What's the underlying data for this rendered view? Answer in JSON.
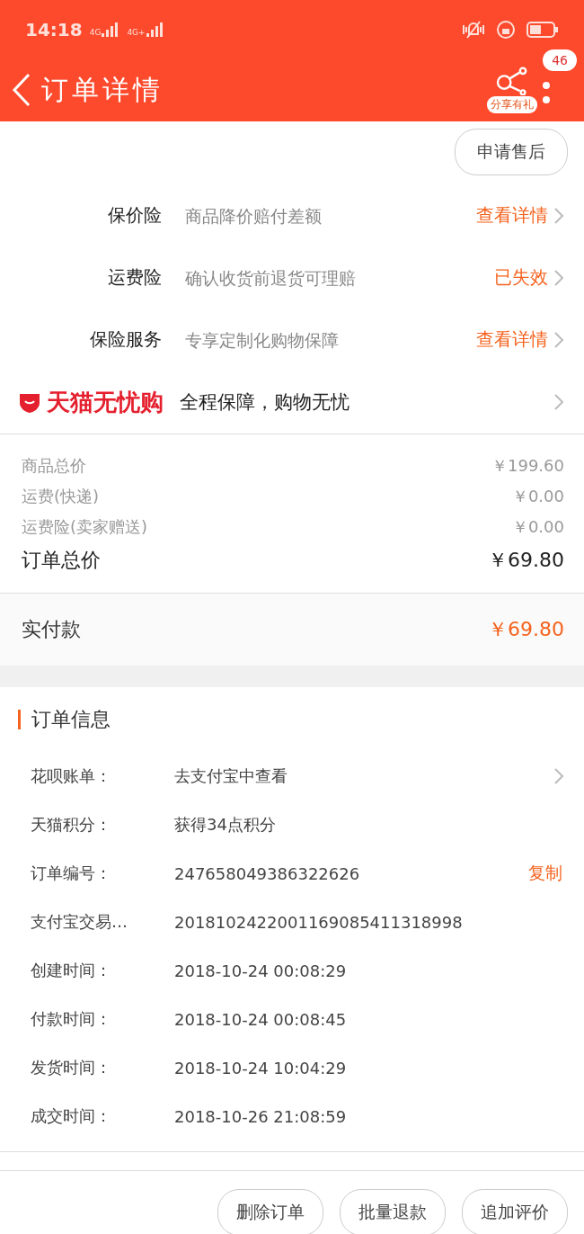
{
  "status_bar": {
    "time": "14:18",
    "networks": [
      "4G",
      "4G+"
    ]
  },
  "nav": {
    "title": "订单详情",
    "share_label": "分享有礼",
    "badge": "46"
  },
  "after_sale_button": "申请售后",
  "insurance": [
    {
      "name": "保价险",
      "desc": "商品降价赔付差额",
      "action": "查看详情"
    },
    {
      "name": "运费险",
      "desc": "确认收货前退货可理赔",
      "action": "已失效"
    },
    {
      "name": "保险服务",
      "desc": "专享定制化购物保障",
      "action": "查看详情"
    }
  ],
  "worry_free": {
    "brand": "天猫无忧购",
    "slogan": "全程保障，购物无忧"
  },
  "prices": [
    {
      "label": "商品总价",
      "value": "￥199.60",
      "kind": "minor"
    },
    {
      "label": "运费(快递)",
      "value": "￥0.00",
      "kind": "minor"
    },
    {
      "label": "运费险(卖家赠送)",
      "value": "￥0.00",
      "kind": "minor"
    },
    {
      "label": "订单总价",
      "value": "￥69.80",
      "kind": "total"
    }
  ],
  "payment": {
    "label": "实付款",
    "value": "￥69.80"
  },
  "order_info": {
    "title": "订单信息",
    "rows": [
      {
        "label": "花呗账单：",
        "value": "去支付宝中查看",
        "kind": "link"
      },
      {
        "label": "天猫积分：",
        "value": "获得34点积分",
        "kind": "plain"
      },
      {
        "label": "订单编号：",
        "value": "247658049386322626",
        "kind": "copy",
        "action": "复制"
      },
      {
        "label": "支付宝交易…",
        "value": "2018102422001169085411318998",
        "kind": "plain"
      },
      {
        "label": "创建时间：",
        "value": "2018-10-24 00:08:29",
        "kind": "plain"
      },
      {
        "label": "付款时间：",
        "value": "2018-10-24 00:08:45",
        "kind": "plain"
      },
      {
        "label": "发货时间：",
        "value": "2018-10-24 10:04:29",
        "kind": "plain"
      },
      {
        "label": "成交时间：",
        "value": "2018-10-26 21:08:59",
        "kind": "plain"
      }
    ]
  },
  "bottom_buttons": [
    "删除订单",
    "批量退款",
    "追加评价"
  ]
}
